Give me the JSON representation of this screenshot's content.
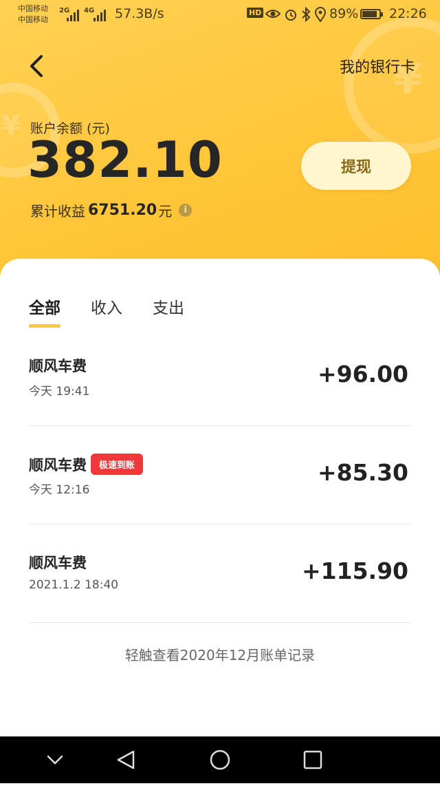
{
  "status_bar": {
    "carrier1": "中国移动",
    "carrier2": "中国移动",
    "net1": "2G",
    "net2": "4G",
    "speed": "57.3B/s",
    "hd": "HD",
    "battery_pct": "89%",
    "battery_level": 0.89,
    "time": "22:26",
    "icons": [
      "eye-icon",
      "alarm-icon",
      "bluetooth-icon",
      "location-icon",
      "battery-icon"
    ]
  },
  "nav": {
    "back_icon": "chevron-left-icon",
    "bank_card_label": "我的银行卡"
  },
  "balance": {
    "label": "账户余额 (元)",
    "value": "382.10",
    "earnings_label": "累计收益",
    "earnings_value": "6751.20",
    "earnings_unit": "元",
    "info_icon": "info-icon"
  },
  "withdraw_label": "提现",
  "tabs": [
    {
      "label": "全部",
      "active": true
    },
    {
      "label": "收入",
      "active": false
    },
    {
      "label": "支出",
      "active": false
    }
  ],
  "transactions": [
    {
      "title": "顺风车费",
      "tag": "",
      "time": "今天  19:41",
      "amount": "+96.00"
    },
    {
      "title": "顺风车费",
      "tag": "极速到账",
      "time": "今天  12:16",
      "amount": "+85.30"
    },
    {
      "title": "顺风车费",
      "tag": "",
      "time": "2021.1.2 18:40",
      "amount": "+115.90"
    }
  ],
  "history_link": "轻触查看2020年12月账单记录",
  "navbar": [
    "chevron-down-icon",
    "back-triangle-icon",
    "home-circle-icon",
    "recents-square-icon"
  ],
  "colors": {
    "header": "#ffc63a",
    "accent": "#ffc83a",
    "tag": "#f0373a"
  }
}
